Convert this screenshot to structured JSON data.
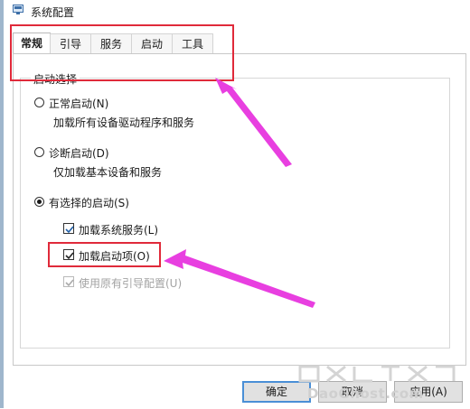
{
  "window": {
    "title": "系统配置"
  },
  "tabs": [
    "常规",
    "引导",
    "服务",
    "启动",
    "工具"
  ],
  "startup_selection": {
    "label": "启动选择",
    "normal": {
      "label": "正常启动(N)",
      "description": "加载所有设备驱动程序和服务",
      "selected": false
    },
    "diagnostic": {
      "label": "诊断启动(D)",
      "description": "仅加载基本设备和服务",
      "selected": false
    },
    "selective": {
      "label": "有选择的启动(S)",
      "selected": true
    },
    "options": [
      {
        "label": "加载系统服务(L)",
        "checked": true,
        "enabled": true
      },
      {
        "label": "加载启动项(O)",
        "checked": true,
        "enabled": true
      },
      {
        "label": "使用原有引导配置(U)",
        "checked": true,
        "enabled": false
      }
    ]
  },
  "buttons": {
    "ok": "确定",
    "cancel": "取消",
    "apply": "应用(A)"
  },
  "watermark": "DaoGhost.com",
  "colors": {
    "highlight_box": "#e02a3a",
    "arrow": "#e83fe0",
    "check": "#1f5fa8"
  }
}
